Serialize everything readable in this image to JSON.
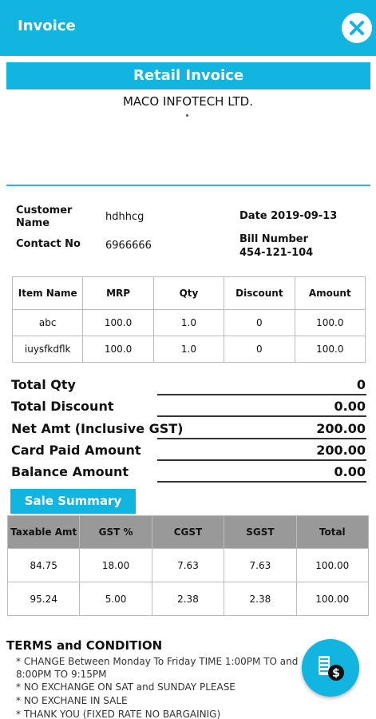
{
  "appbar": {
    "title": "Invoice"
  },
  "invoice": {
    "banner": "Retail Invoice",
    "company": "MACO INFOTECH LTD."
  },
  "customer": {
    "name_label": "Customer Name",
    "name_value": "hdhhcg",
    "contact_label": "Contact No",
    "contact_value": "6966666",
    "date_text": "Date 2019-09-13",
    "bill_label": "Bill Number",
    "bill_value": "454-121-104"
  },
  "items_table": {
    "headers": [
      "Item Name",
      "MRP",
      "Qty",
      "Discount",
      "Amount"
    ],
    "rows": [
      [
        "abc",
        "100.0",
        "1.0",
        "0",
        "100.0"
      ],
      [
        "iuysfkdflk",
        "100.0",
        "1.0",
        "0",
        "100.0"
      ]
    ]
  },
  "totals": [
    {
      "label": "Total Qty",
      "value": "0"
    },
    {
      "label": "Total Discount",
      "value": "0.00"
    },
    {
      "label": "Net Amt (Inclusive GST)",
      "value": "200.00"
    },
    {
      "label": "Card Paid Amount",
      "value": "200.00"
    },
    {
      "label": "Balance Amount",
      "value": "0.00"
    }
  ],
  "sale_summary": {
    "tab_label": "Sale Summary",
    "headers": [
      "Taxable Amt",
      "GST %",
      "CGST",
      "SGST",
      "Total"
    ],
    "rows": [
      [
        "84.75",
        "18.00",
        "7.63",
        "7.63",
        "100.00"
      ],
      [
        "95.24",
        "5.00",
        "2.38",
        "2.38",
        "100.00"
      ]
    ]
  },
  "terms": {
    "title": "TERMS and CONDITION",
    "items": [
      "* CHANGE Between Monday To Friday TIME 1:00PM TO and 8:00PM TO 9:15PM",
      "* NO EXCHANGE ON SAT and SUNDAY PLEASE",
      "* NO EXCHANE IN SALE",
      "* THANK YOU (FIXED RATE NO BARGAINIG)"
    ]
  },
  "colors": {
    "accent": "#11b5e0",
    "summary_header": "#999999"
  },
  "icons": {
    "close": "close-icon",
    "fab": "payment-receipt-icon"
  }
}
